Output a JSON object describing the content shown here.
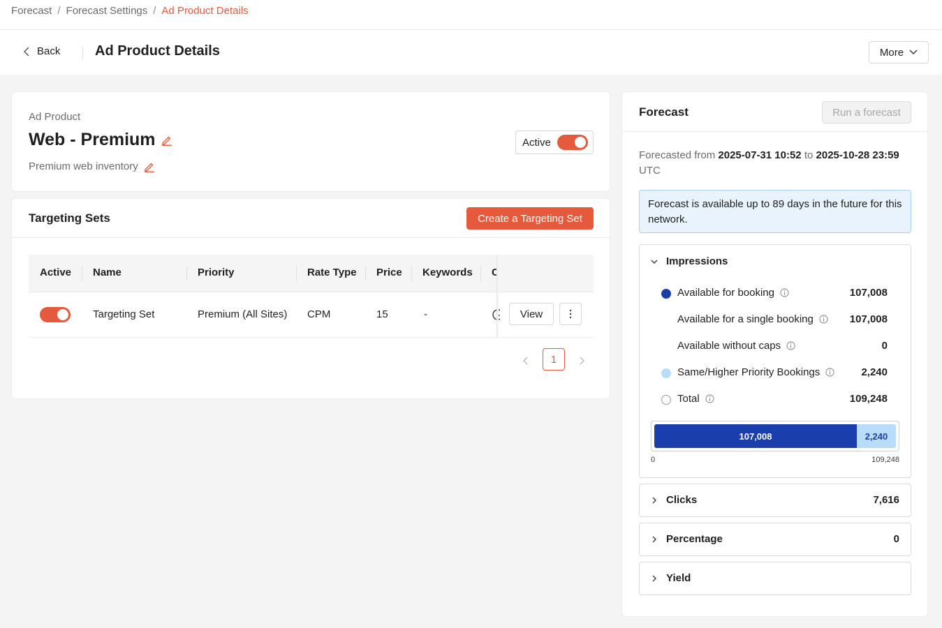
{
  "breadcrumb": {
    "items": [
      "Forecast",
      "Forecast Settings",
      "Ad Product Details"
    ],
    "separator": "/"
  },
  "header": {
    "back_label": "Back",
    "title": "Ad Product Details",
    "more_label": "More"
  },
  "product": {
    "section_label": "Ad Product",
    "name": "Web - Premium",
    "description": "Premium web inventory",
    "status_label": "Active",
    "status_on": true
  },
  "targeting": {
    "title": "Targeting Sets",
    "create_label": "Create a Targeting Set",
    "columns": [
      "Active",
      "Name",
      "Priority",
      "Rate Type",
      "Price",
      "Keywords",
      "C"
    ],
    "rows": [
      {
        "active": true,
        "name": "Targeting Set",
        "priority": "Premium (All Sites)",
        "rate_type": "CPM",
        "price": "15",
        "keywords": "-",
        "view_label": "View"
      }
    ],
    "pagination": {
      "current_page": "1"
    }
  },
  "forecast": {
    "title": "Forecast",
    "run_label": "Run a forecast",
    "range_prefix": "Forecasted from",
    "range_start": "2025-07-31 10:52",
    "range_mid": "to",
    "range_end": "2025-10-28 23:59",
    "range_tz": "UTC",
    "info": "Forecast is available up to 89 days in the future for this network.",
    "impressions": {
      "title": "Impressions",
      "rows": [
        {
          "label": "Available for booking",
          "value": "107,008",
          "dot": "#1a3fad"
        },
        {
          "label": "Available for a single booking",
          "value": "107,008",
          "dot": ""
        },
        {
          "label": "Available without caps",
          "value": "0",
          "dot": ""
        },
        {
          "label": "Same/Higher Priority Bookings",
          "value": "2,240",
          "dot": "#b9dcfb"
        },
        {
          "label": "Total",
          "value": "109,248",
          "dot": "outline"
        }
      ],
      "bar": {
        "segments": [
          {
            "label": "107,008",
            "value": 107008,
            "color": "#1a3fad",
            "text_color": "#ffffff"
          },
          {
            "label": "2,240",
            "value": 2240,
            "color": "#b9dcfb",
            "text_color": "#1a3fad"
          }
        ],
        "total": 109248,
        "axis_min": "0",
        "axis_max": "109,248"
      }
    },
    "clicks": {
      "title": "Clicks",
      "value": "7,616"
    },
    "percentage": {
      "title": "Percentage",
      "value": "0"
    },
    "yield": {
      "title": "Yield"
    }
  },
  "colors": {
    "accent": "#e55a3c",
    "booking": "#1a3fad",
    "priority": "#b9dcfb",
    "info_bg": "#e8f3fd"
  }
}
